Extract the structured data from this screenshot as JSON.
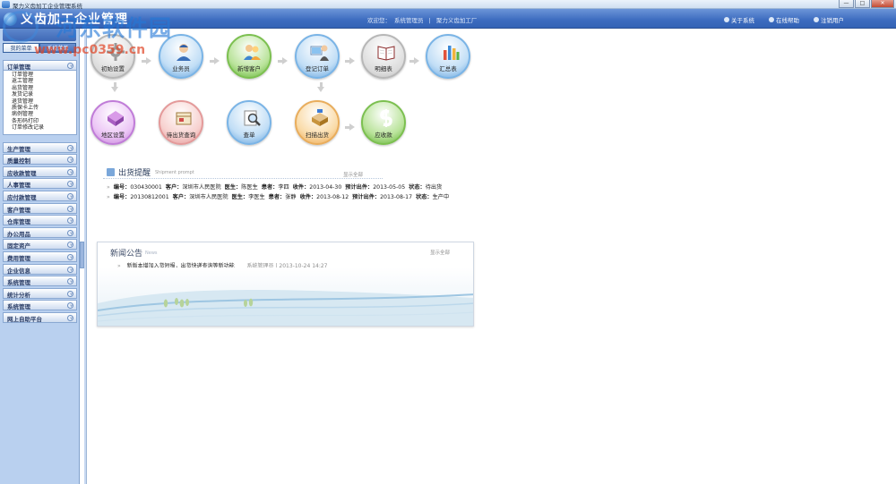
{
  "window": {
    "title": "聚力义齿加工企业管理系统",
    "controls": [
      "—",
      "□",
      "✕"
    ]
  },
  "header": {
    "brand": "义齿加工企业管理",
    "welcome": "欢迎您：",
    "user": "系统管理员",
    "separator": "|",
    "company": "聚力义齿加工厂",
    "links": [
      {
        "label": "关于系统",
        "icon": "info-icon"
      },
      {
        "label": "在线帮助",
        "icon": "help-icon"
      },
      {
        "label": "注销用户",
        "icon": "logout-icon"
      }
    ]
  },
  "watermark": {
    "line1": "河东软件园",
    "line2": "www.pc0359.cn"
  },
  "sidebar": {
    "tabs": [
      "我的菜单",
      "系统菜单"
    ],
    "groups": [
      {
        "label": "订单管理",
        "items": [
          "订单管理",
          "返工管理",
          "出货管理",
          "发货记录",
          "退货管理",
          "质保卡上传",
          "病例管理",
          "条形码打印",
          "订单修改记录"
        ]
      },
      {
        "label": "生产管理"
      },
      {
        "label": "质量控制"
      },
      {
        "label": "应收款管理"
      },
      {
        "label": "人事管理"
      },
      {
        "label": "应付款管理"
      },
      {
        "label": "客户管理"
      },
      {
        "label": "仓库管理"
      },
      {
        "label": "办公用品"
      },
      {
        "label": "固定资产"
      },
      {
        "label": "费用管理"
      },
      {
        "label": "企业信息"
      },
      {
        "label": "系统管理"
      },
      {
        "label": "统计分析"
      },
      {
        "label": "系统管理"
      },
      {
        "label": "网上自助平台"
      }
    ]
  },
  "workflow": {
    "row1": [
      {
        "label": "初始设置",
        "icon": "gear-icon",
        "color": "grey"
      },
      {
        "label": "业务员",
        "icon": "salesman-icon",
        "color": "blue"
      },
      {
        "label": "新增客户",
        "icon": "add-customer-icon",
        "color": "green"
      },
      {
        "label": "登记订单",
        "icon": "register-order-icon",
        "color": "blue"
      },
      {
        "label": "明细表",
        "icon": "book-icon",
        "color": "grey"
      },
      {
        "label": "汇总表",
        "icon": "bar-chart-icon",
        "color": "blue"
      }
    ],
    "row2": [
      {
        "label": "地区设置",
        "icon": "region-icon",
        "color": "purple"
      },
      {
        "label": "待出货查询",
        "icon": "pending-shipment-icon",
        "color": "pink"
      },
      {
        "label": "查单",
        "icon": "search-order-icon",
        "color": "blue"
      },
      {
        "label": "扫描出货",
        "icon": "scan-ship-icon",
        "color": "orange"
      },
      {
        "label": "应收款",
        "icon": "receivable-icon",
        "color": "green"
      }
    ]
  },
  "shipment": {
    "title": "出货提醒",
    "subtitle": "Shipment prompt",
    "more": "显示全部",
    "rows": [
      {
        "no_label": "编号：",
        "no": "030430001",
        "customer_label": "客户：",
        "customer": "深圳市人民医院",
        "doctor_label": "医生：",
        "doctor": "陈医生",
        "patient_label": "患者：",
        "patient": "李四",
        "received_label": "收件：",
        "received": "2013-04-30",
        "expected_label": "预计出件：",
        "expected": "2013-05-05",
        "status_label": "状态：",
        "status": "待出货"
      },
      {
        "no_label": "编号：",
        "no": "20130812001",
        "customer_label": "客户：",
        "customer": "深圳市人民医院",
        "doctor_label": "医生：",
        "doctor": "李医生",
        "patient_label": "患者：",
        "patient": "张静",
        "received_label": "收件：",
        "received": "2013-08-12",
        "expected_label": "预计出件：",
        "expected": "2013-08-17",
        "status_label": "状态：",
        "status": "生产中"
      }
    ]
  },
  "news": {
    "title": "新闻公告",
    "subtitle": "News",
    "more": "显示全部",
    "items": [
      {
        "text": "新版本增加入货短报，出货快递查询等新功能",
        "author": "系统管理员",
        "sep": "|",
        "date": "2013-10-24 14:27"
      }
    ]
  },
  "colors": {
    "header": "#3c6bbf",
    "sidebar": "#b9d0ef",
    "watermark_blue": "#2378d7",
    "watermark_red": "#e14628"
  }
}
